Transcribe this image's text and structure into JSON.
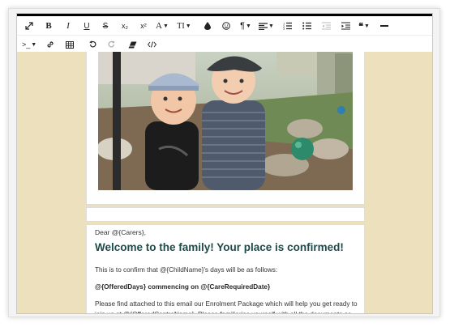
{
  "toolbar": {
    "row1": [
      {
        "name": "fullscreen-icon",
        "glyph": "⤢"
      },
      {
        "name": "bold-button",
        "glyph": "B"
      },
      {
        "name": "italic-button",
        "glyph": "I"
      },
      {
        "name": "underline-button",
        "glyph": "U"
      },
      {
        "name": "strikethrough-button",
        "glyph": "S"
      },
      {
        "name": "subscript-button",
        "glyph": "x₂"
      },
      {
        "name": "superscript-button",
        "glyph": "x²"
      },
      {
        "name": "font-color-button",
        "glyph": "A"
      },
      {
        "name": "font-size-button",
        "glyph": "TI"
      },
      {
        "name": "highlight-icon",
        "glyph": "💧"
      },
      {
        "name": "emoji-icon",
        "glyph": "☺"
      },
      {
        "name": "paragraph-format-button",
        "glyph": "¶"
      },
      {
        "name": "align-button",
        "glyph": "≡"
      },
      {
        "name": "ordered-list-button",
        "glyph": "1≡"
      },
      {
        "name": "unordered-list-button",
        "glyph": "•≡"
      },
      {
        "name": "outdent-button",
        "glyph": "⇤"
      },
      {
        "name": "indent-button",
        "glyph": "⇥"
      },
      {
        "name": "quote-button",
        "glyph": "❝"
      },
      {
        "name": "horizontal-line-button",
        "glyph": "—"
      }
    ],
    "row2": [
      {
        "name": "insert-special-button",
        "glyph": ">_"
      },
      {
        "name": "link-icon",
        "glyph": "🔗"
      },
      {
        "name": "table-icon",
        "glyph": "▦"
      },
      {
        "name": "undo-icon",
        "glyph": "↶"
      },
      {
        "name": "redo-icon",
        "glyph": "↷"
      },
      {
        "name": "clear-formatting-icon",
        "glyph": "⌫"
      },
      {
        "name": "code-view-icon",
        "glyph": "</>"
      }
    ]
  },
  "letter": {
    "greeting": "Dear @{Carers},",
    "headline": "Welcome to the family! Your place is confirmed!",
    "para1": "This is to confirm that @{ChildName}'s days will be as follows:",
    "para2": "@{OfferedDays} commencing on @{CareRequiredDate}",
    "para3": "Please find attached to this email our Enrolment Package which will help you get ready to join us at @{OfferedCentreName}. Please familiarise yourself with all the documents as they will provide you with valuable information regarding our centre."
  }
}
